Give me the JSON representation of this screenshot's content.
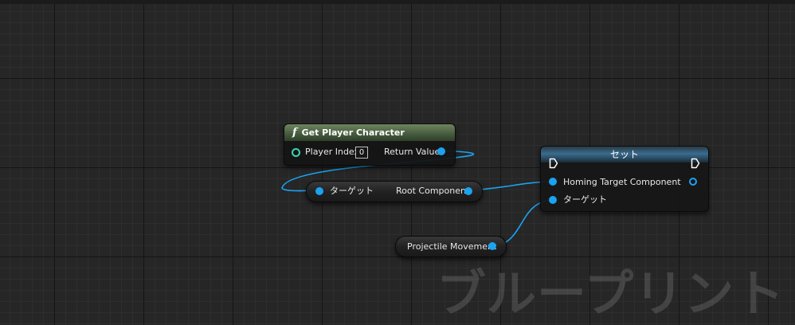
{
  "editor": {
    "watermark": "ブループリント"
  },
  "nodes": {
    "get_player_character": {
      "title": "Get Player Character",
      "title_icon": "function-icon",
      "player_index_label": "Player Index",
      "player_index_value": "0",
      "return_value_label": "Return Value"
    },
    "root_component_getter": {
      "target_label": "ターゲット",
      "output_label": "Root Component"
    },
    "set_node": {
      "title": "セット",
      "input_label": "Homing Target Component",
      "target_label": "ターゲット"
    },
    "projectile_movement": {
      "label": "Projectile Movement"
    }
  },
  "colors": {
    "object_pin": "#1aa3f0",
    "int_pin": "#3bd6b0",
    "pure_function_header": "#445a3d",
    "set_header": "#3a6c8e"
  }
}
